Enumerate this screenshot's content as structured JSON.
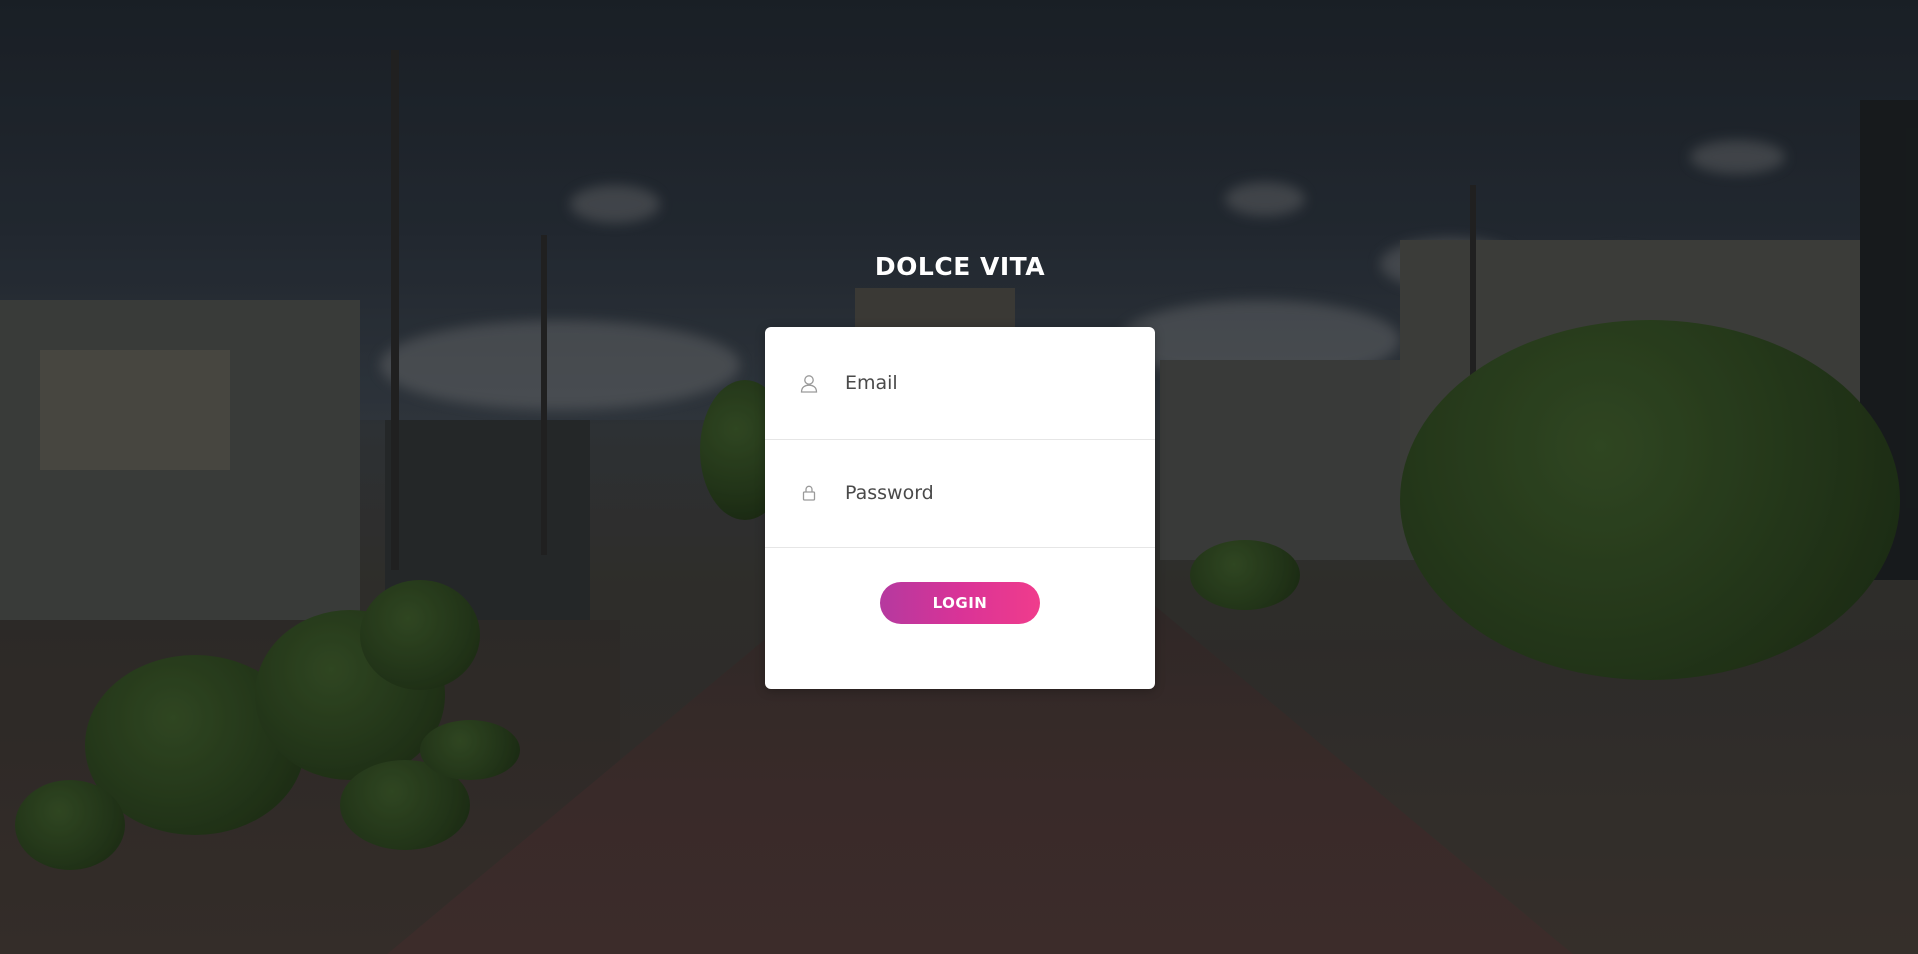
{
  "brand": {
    "title": "DOLCE VITA"
  },
  "login_form": {
    "email": {
      "placeholder": "Email",
      "value": "",
      "icon": "user-icon"
    },
    "password": {
      "placeholder": "Password",
      "value": "",
      "icon": "lock-icon"
    },
    "submit_label": "LOGIN"
  },
  "colors": {
    "button_gradient_start": "#b5399f",
    "button_gradient_end": "#f03c8c",
    "card_background": "#ffffff",
    "title_color": "#ffffff"
  }
}
